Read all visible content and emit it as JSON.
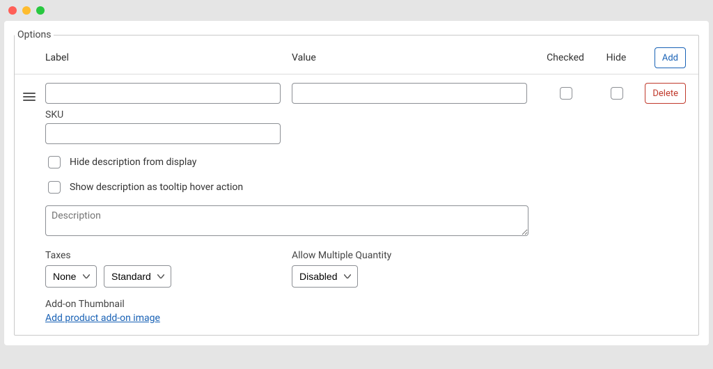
{
  "fieldset_title": "Options",
  "columns": {
    "label": "Label",
    "value": "Value",
    "checked": "Checked",
    "hide": "Hide"
  },
  "buttons": {
    "add": "Add",
    "delete": "Delete"
  },
  "row": {
    "label_value": "",
    "value_value": "",
    "checked": false,
    "hide": false
  },
  "sku": {
    "label": "SKU",
    "value": ""
  },
  "hide_description": {
    "label": "Hide description from display",
    "checked": false
  },
  "tooltip_description": {
    "label": "Show description as tooltip hover action",
    "checked": false
  },
  "description": {
    "placeholder": "Description",
    "value": ""
  },
  "taxes": {
    "label": "Taxes",
    "select1": "None",
    "select2": "Standard"
  },
  "multiple_qty": {
    "label": "Allow Multiple Quantity",
    "select": "Disabled"
  },
  "thumbnail": {
    "label": "Add-on Thumbnail",
    "link": "Add product add-on image"
  }
}
